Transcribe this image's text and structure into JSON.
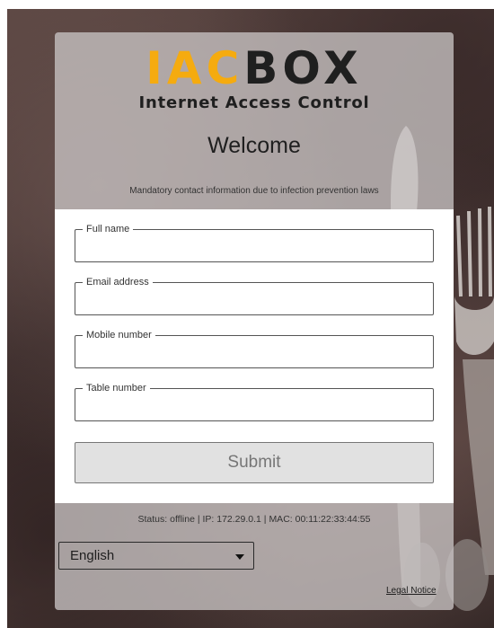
{
  "brand": {
    "logo_part1": "IAC",
    "logo_part2": "BOX",
    "tagline": "Internet Access Control"
  },
  "page": {
    "title": "Welcome",
    "notice": "Mandatory contact information due to infection prevention laws"
  },
  "form": {
    "fields": [
      {
        "label": "Full name",
        "value": ""
      },
      {
        "label": "Email address",
        "value": ""
      },
      {
        "label": "Mobile number",
        "value": ""
      },
      {
        "label": "Table number",
        "value": ""
      }
    ],
    "submit_label": "Submit"
  },
  "footer": {
    "status": "Status: offline | IP: 172.29.0.1 | MAC: 00:11:22:33:44:55",
    "language": "English",
    "legal_label": "Legal Notice"
  },
  "colors": {
    "brand_accent": "#f5ab0f",
    "brand_dark": "#1f1f1f"
  }
}
